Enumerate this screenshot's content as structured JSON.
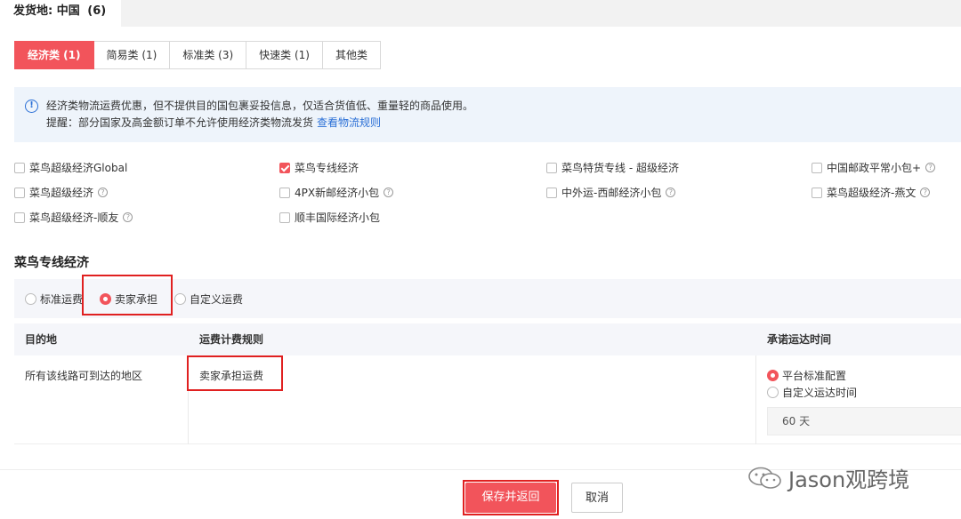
{
  "origin": {
    "label": "发货地:",
    "name": "中国",
    "count": "(6)"
  },
  "category_tabs": [
    {
      "label": "经济类 (1)"
    },
    {
      "label": "简易类 (1)"
    },
    {
      "label": "标准类 (3)"
    },
    {
      "label": "快速类 (1)"
    },
    {
      "label": "其他类"
    }
  ],
  "info": {
    "line1": "经济类物流运费优惠，但不提供目的国包裹妥投信息，仅适合货值低、重量轻的商品使用。",
    "line2": "提醒：部分国家及高金额订单不允许使用经济类物流发货",
    "link": "查看物流规则"
  },
  "services": [
    {
      "label": "菜鸟超级经济Global"
    },
    {
      "label": "菜鸟专线经济"
    },
    {
      "label": "菜鸟特货专线 - 超级经济"
    },
    {
      "label": "中国邮政平常小包+"
    },
    {
      "label": "菜鸟超级经济"
    },
    {
      "label": "4PX新邮经济小包"
    },
    {
      "label": "中外运-西邮经济小包"
    },
    {
      "label": "菜鸟超级经济-燕文"
    },
    {
      "label": "菜鸟超级经济-顺友"
    },
    {
      "label": "顺丰国际经济小包"
    }
  ],
  "section_title": "菜鸟专线经济",
  "freight_options": [
    {
      "label": "标准运费"
    },
    {
      "label": "卖家承担"
    },
    {
      "label": "自定义运费"
    }
  ],
  "table": {
    "headers": [
      "目的地",
      "运费计费规则",
      "承诺运达时间"
    ],
    "row": {
      "destination": "所有该线路可到达的地区",
      "rule": "卖家承担运费"
    }
  },
  "delivery": {
    "options": [
      {
        "label": "平台标准配置"
      },
      {
        "label": "自定义运达时间"
      }
    ],
    "days_value": "60 天"
  },
  "footer": {
    "save_label": "保存并返回",
    "cancel_label": "取消"
  },
  "watermark": {
    "text": "Jason观跨境"
  },
  "colors": {
    "accent": "#f2545b",
    "link": "#2a6fd6",
    "highlight": "#e02020"
  }
}
